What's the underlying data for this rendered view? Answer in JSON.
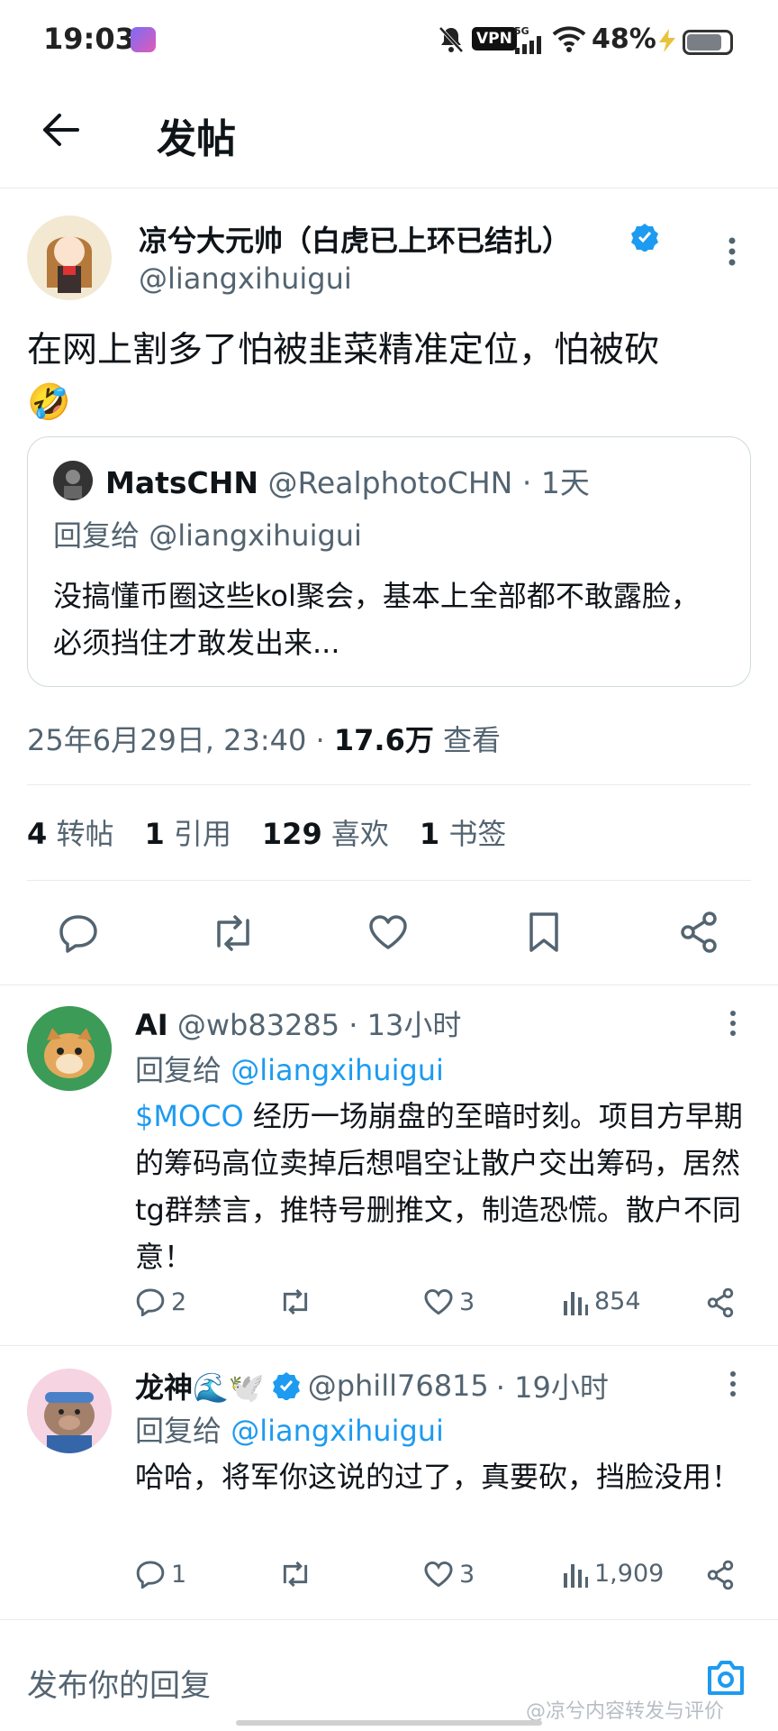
{
  "status_bar": {
    "time": "19:03",
    "vpn": "VPN",
    "signal_label": "5G",
    "battery_pct": "48%",
    "battery_level": 0.48
  },
  "header": {
    "title": "发帖"
  },
  "post": {
    "author_name": "凉兮大元帅（白虎已上环已结扎）",
    "author_handle": "@liangxihuigui",
    "text": "在网上割多了怕被韭菜精准定位，怕被砍",
    "emoji": "🤣",
    "quote": {
      "author_name": "MatsCHN",
      "author_handle": "@RealphotoCHN",
      "time": "· 1天",
      "reply_prefix": "回复给",
      "reply_to": "@liangxihuigui",
      "text": "没搞懂币圈这些kol聚会，基本上全部都不敢露脸，必须挡住才敢发出来..."
    },
    "timestamp": "25年6月29日, 23:40 ·",
    "views_count": "17.6万",
    "views_label": "查看",
    "stats": [
      {
        "count": "4",
        "label": "转帖"
      },
      {
        "count": "1",
        "label": "引用"
      },
      {
        "count": "129",
        "label": "喜欢"
      },
      {
        "count": "1",
        "label": "书签"
      }
    ]
  },
  "replies": [
    {
      "author_name": "AI",
      "author_handle": "@wb83285",
      "time": "· 13小时",
      "reply_prefix": "回复给",
      "reply_to": "@liangxihuigui",
      "cashtag": "$MOCO",
      "text": " 经历一场崩盘的至暗时刻。项目方早期的筹码高位卖掉后想唱空让散户交出筹码，居然tg群禁言，推特号删推文，制造恐慌。散户不同意！",
      "reply_count": "2",
      "like_count": "3",
      "view_count": "854"
    },
    {
      "author_name": "龙神🌊🕊️",
      "author_handle": "@phill76815",
      "time": "· 19小时",
      "reply_prefix": "回复给",
      "reply_to": "@liangxihuigui",
      "text": "哈哈，将军你这说的过了，真要砍，挡脸没用！",
      "reply_count": "1",
      "like_count": "3",
      "view_count": "1,909"
    }
  ],
  "composer": {
    "placeholder": "发布你的回复"
  },
  "watermark": "@凉兮内容转发与评价",
  "colors": {
    "accent": "#1d9bf0",
    "secondary_text": "#536471",
    "divider": "#e6ecf0"
  }
}
